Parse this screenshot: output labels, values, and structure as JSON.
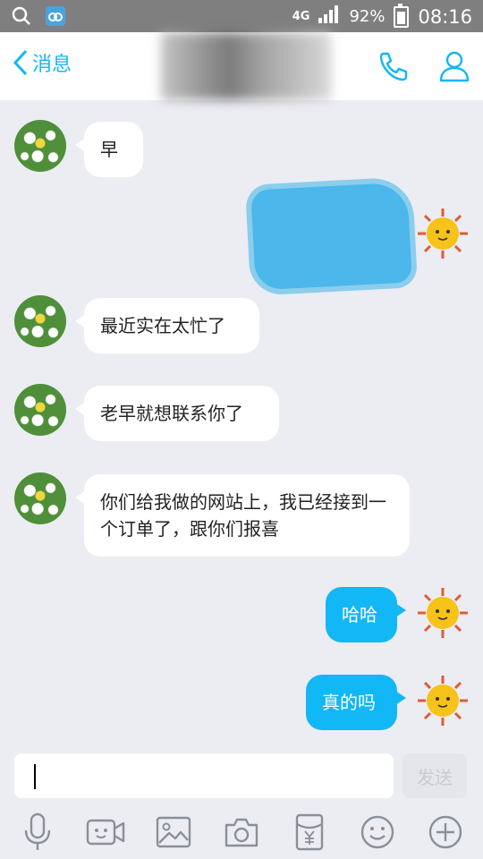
{
  "status_bar": {
    "network": "4G",
    "battery": "92%",
    "time": "08:16"
  },
  "nav": {
    "back_label": "消息",
    "accent_color": "#12b7f5"
  },
  "messages": [
    {
      "side": "left",
      "text": "早"
    },
    {
      "side": "right",
      "text": ""
    },
    {
      "side": "left",
      "text": "最近实在太忙了"
    },
    {
      "side": "left",
      "text": "老早就想联系你了"
    },
    {
      "side": "left",
      "text": "你们给我做的网站上，我已经接到一个订单了，跟你们报喜"
    },
    {
      "side": "right",
      "text": "哈哈"
    },
    {
      "side": "right",
      "text": "真的吗"
    }
  ],
  "composer": {
    "send_label": "发送"
  },
  "toolbar_icons": [
    "microphone-icon",
    "video-icon",
    "image-icon",
    "camera-icon",
    "red-packet-icon",
    "emoji-icon",
    "plus-icon"
  ]
}
